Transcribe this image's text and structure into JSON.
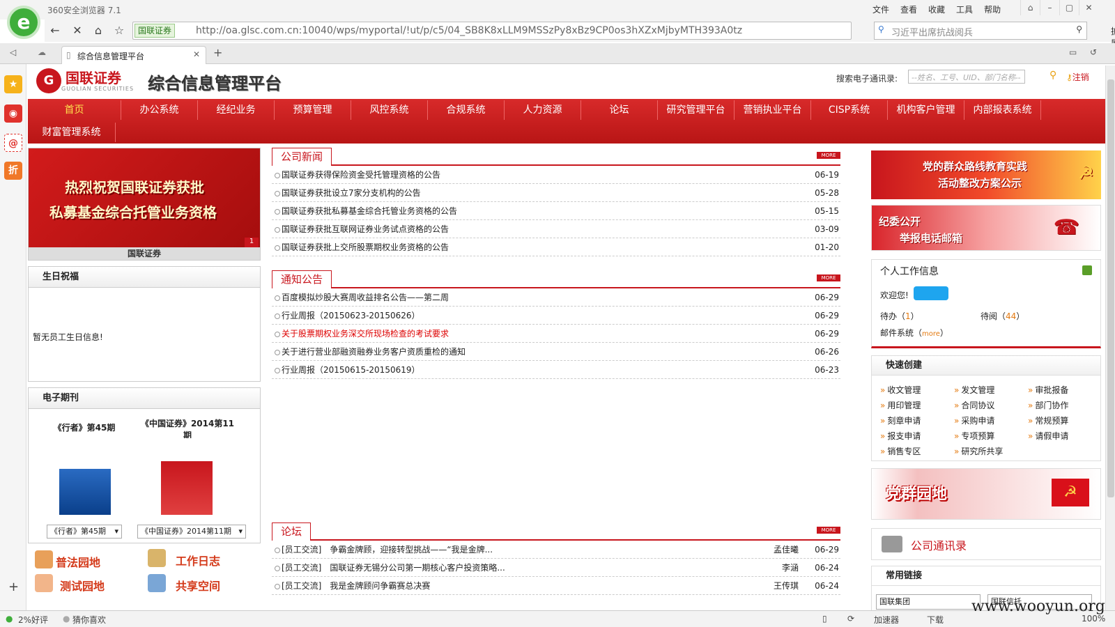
{
  "browser": {
    "app_name": "360安全浏览器 7.1",
    "menus": [
      "文件",
      "查看",
      "收藏",
      "工具",
      "帮助"
    ],
    "security_badge": "国联证券",
    "url": "http://oa.glsc.com.cn:10040/wps/myportal/!ut/p/c5/04_SB8K8xLLM9MSSzPy8xBz9CP0os3hXZxMjbyMTH393A0tz",
    "search_text": "习近平出席抗战阅兵",
    "ext_label": "扩展",
    "tab_title": "综合信息管理平台",
    "status_left": "2%好评",
    "status_guess": "猜你喜欢",
    "status_accel": "加速器",
    "status_download": "下载",
    "zoom": "100%"
  },
  "header": {
    "brand_cn": "国联证券",
    "brand_en": "GUOLIAN SECURITIES",
    "platform": "综合信息管理平台",
    "search_label": "搜索电子通讯录:",
    "search_placeholder": "--姓名、工号、UID、部门名称--",
    "logout": "注销"
  },
  "nav": {
    "row1": [
      "首页",
      "办公系统",
      "经纪业务",
      "预算管理",
      "风控系统",
      "合规系统",
      "人力资源",
      "论坛",
      "研究管理平台",
      "营销执业平台",
      "CISP系统",
      "机构客户管理",
      "内部报表系统"
    ],
    "row2": [
      "财富管理系统"
    ]
  },
  "banner": {
    "line1": "热烈祝贺国联证券获批",
    "line2": "私募基金综合托管业务资格",
    "index": "1",
    "caption": "国联证券"
  },
  "birthday": {
    "title": "生日祝福",
    "empty": "暂无员工生日信息!"
  },
  "journals": {
    "title": "电子期刊",
    "items": [
      {
        "name": "《行者》第45期",
        "select": "《行者》第45期"
      },
      {
        "name": "《中国证券》2014第11期",
        "select": "《中国证券》2014第11期"
      }
    ]
  },
  "bottom_links": [
    "普法园地",
    "工作日志",
    "测试园地",
    "共享空间"
  ],
  "news": {
    "title": "公司新闻",
    "more": "MORE",
    "items": [
      {
        "text": "国联证券获得保险资金受托管理资格的公告",
        "date": "06-19"
      },
      {
        "text": "国联证券获批设立7家分支机构的公告",
        "date": "05-28"
      },
      {
        "text": "国联证券获批私募基金综合托管业务资格的公告",
        "date": "05-15"
      },
      {
        "text": "国联证券获批互联网证券业务试点资格的公告",
        "date": "03-09"
      },
      {
        "text": "国联证券获批上交所股票期权业务资格的公告",
        "date": "01-20"
      }
    ]
  },
  "notices": {
    "title": "通知公告",
    "more": "MORE",
    "items": [
      {
        "text": "百度模拟炒股大赛周收益排名公告——第二周",
        "date": "06-29"
      },
      {
        "text": "行业周报（20150623-20150626）",
        "date": "06-29"
      },
      {
        "text": "关于股票期权业务深交所现场检查的考试要求",
        "date": "06-29"
      },
      {
        "text": "关于进行营业部融资融券业务客户资质重检的通知",
        "date": "06-26"
      },
      {
        "text": "行业周报（20150615-20150619）",
        "date": "06-23"
      }
    ]
  },
  "forum": {
    "title": "论坛",
    "more": "MORE",
    "items": [
      {
        "text": "[员工交流]　争霸金牌顾，迎接转型挑战——“我是金牌...",
        "author": "孟佳曦",
        "date": "06-29"
      },
      {
        "text": "[员工交流]　国联证券无锡分公司第一期核心客户投资策略...",
        "author": "李涵",
        "date": "06-24"
      },
      {
        "text": "[员工交流]　我是金牌顾问争霸赛总决赛",
        "author": "王传琪",
        "date": "06-24"
      }
    ]
  },
  "right": {
    "banner1_l1": "党的群众路线教育实践",
    "banner1_l2": "活动整改方案公示",
    "banner2_l1": "纪委公开",
    "banner2_l2": "举报电话邮箱",
    "personal_title": "个人工作信息",
    "welcome": "欢迎您!",
    "todo": "待办（",
    "todo_count": "1",
    "toread": "待阅（",
    "toread_count": "44",
    "close_paren": "）",
    "mail": "邮件系统（",
    "mail_more": "more",
    "quick_title": "快速创建",
    "quick_links": [
      "收文管理",
      "发文管理",
      "审批报备",
      "用印管理",
      "合同协议",
      "部门协作",
      "刻章申请",
      "采购申请",
      "常规预算",
      "报支申请",
      "专项预算",
      "请假申请",
      "销售专区",
      "研究所共享"
    ],
    "dangqun": "党群园地",
    "contacts": "公司通讯录",
    "links_title": "常用链接",
    "links_sel1": "国联集团",
    "links_sel2": "国联信托"
  },
  "watermark": "www.wooyun.org"
}
